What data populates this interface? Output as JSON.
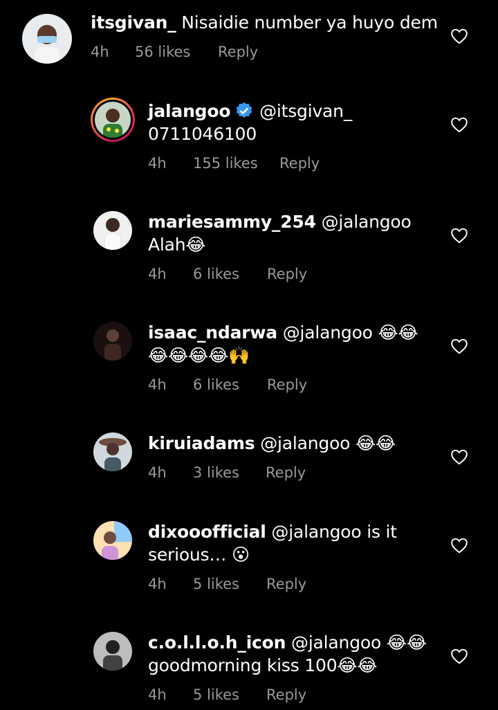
{
  "comments": [
    {
      "username": "itsgivan_",
      "text": "Nisaidie number ya huyo dem",
      "time": "4h",
      "likes": "56 likes",
      "reply": "Reply"
    },
    {
      "username": "jalangoo",
      "verified": true,
      "mention": "@itsgivan_",
      "text": "0711046100",
      "time": "4h",
      "likes": "155 likes",
      "reply": "Reply"
    },
    {
      "username": "mariesammy_254",
      "mention": "@jalangoo",
      "text": "Alah😂",
      "time": "4h",
      "likes": "6 likes",
      "reply": "Reply"
    },
    {
      "username": "isaac_ndarwa",
      "mention": "@jalangoo",
      "text_line1": "😂😂",
      "text_line2": "😂😂😂😂🙌",
      "time": "4h",
      "likes": "6 likes",
      "reply": "Reply"
    },
    {
      "username": "kiruiadams",
      "mention": "@jalangoo",
      "text": "😂😂",
      "time": "4h",
      "likes": "3 likes",
      "reply": "Reply"
    },
    {
      "username": "dixooofficial",
      "mention": "@jalangoo",
      "text_line1": "is it",
      "text_line2": "serious… 😮",
      "time": "4h",
      "likes": "5 likes",
      "reply": "Reply"
    },
    {
      "username": "c.o.l.l.o.h_icon",
      "mention": "@jalangoo",
      "text_line1": "😂😂",
      "text_line2": "goodmorning kiss 100😂😂",
      "time": "4h",
      "likes": "5 likes",
      "reply": "Reply"
    }
  ],
  "icons": {
    "like": "heart-outline-icon",
    "verified": "verified-badge-icon"
  },
  "colors": {
    "background": "#000000",
    "text": "#ffffff",
    "meta": "#9a9a9a",
    "verified": "#3897f0"
  }
}
